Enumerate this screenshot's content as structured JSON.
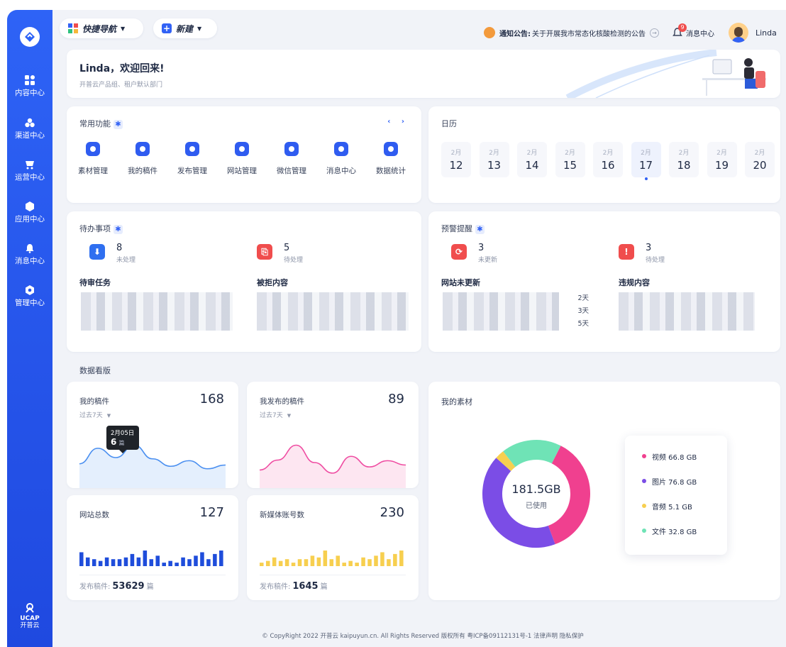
{
  "sidebar": {
    "items": [
      {
        "label": "内容中心",
        "icon": "grid-icon"
      },
      {
        "label": "渠道中心",
        "icon": "channels-icon"
      },
      {
        "label": "运营中心",
        "icon": "cart-icon"
      },
      {
        "label": "应用中心",
        "icon": "cube-icon"
      },
      {
        "label": "消息中心",
        "icon": "bell-icon"
      },
      {
        "label": "管理中心",
        "icon": "gear-icon"
      }
    ],
    "brand": "UCAP",
    "brand_sub": "开普云"
  },
  "topbar": {
    "quick_nav": "快捷导航",
    "new_label": "新建",
    "notice_label": "通知公告:",
    "notice_text": "关于开展我市常态化核酸检测的公告",
    "message_center": "消息中心",
    "message_count": "9",
    "user": "Linda"
  },
  "welcome": {
    "title": "Linda，欢迎回来!",
    "subtitle": "开普云产品组、租户默认部门"
  },
  "quick_functions": {
    "title": "常用功能",
    "items": [
      "素材管理",
      "我的稿件",
      "发布管理",
      "网站管理",
      "微信管理",
      "消息中心",
      "数据统计"
    ]
  },
  "calendar": {
    "title": "日历",
    "days": [
      {
        "month": "2月",
        "day": "12"
      },
      {
        "month": "2月",
        "day": "13"
      },
      {
        "month": "2月",
        "day": "14"
      },
      {
        "month": "2月",
        "day": "15"
      },
      {
        "month": "2月",
        "day": "16"
      },
      {
        "month": "2月",
        "day": "17"
      },
      {
        "month": "2月",
        "day": "18"
      },
      {
        "month": "2月",
        "day": "19"
      },
      {
        "month": "2月",
        "day": "20"
      }
    ],
    "selected_day": "17"
  },
  "todo": {
    "title": "待办事项",
    "groups": [
      {
        "count": "8",
        "status": "未处理",
        "label": "待审任务"
      },
      {
        "count": "5",
        "status": "待处理",
        "label": "被拒内容"
      }
    ]
  },
  "alerts": {
    "title": "预警提醒",
    "groups": [
      {
        "count": "3",
        "status": "未更新",
        "label": "网站未更新",
        "days": [
          "2天",
          "3天",
          "5天"
        ]
      },
      {
        "count": "3",
        "status": "待处理",
        "label": "违规内容"
      }
    ]
  },
  "dashboard": {
    "title": "数据看版",
    "my_drafts": {
      "title": "我的稿件",
      "value": "168",
      "period": "过去7天",
      "tooltip_date": "2月05日",
      "tooltip_value": "6",
      "tooltip_unit": "篇"
    },
    "my_published": {
      "title": "我发布的稿件",
      "value": "89",
      "period": "过去7天"
    },
    "site_total": {
      "title": "网站总数",
      "value": "127",
      "foot_label": "发布稿件:",
      "foot_value": "53629",
      "foot_unit": "篇"
    },
    "media_accounts": {
      "title": "新媒体账号数",
      "value": "230",
      "foot_label": "发布稿件:",
      "foot_value": "1645",
      "foot_unit": "篇"
    }
  },
  "materials": {
    "title": "我的素材",
    "total": "181.5GB",
    "total_label": "已使用",
    "colors": {
      "视频": "#f0408f",
      "图片": "#7b4de6",
      "音频": "#f7cf4f",
      "文件": "#6fe3b6"
    }
  },
  "chart_data": [
    {
      "type": "pie",
      "title": "我的素材",
      "categories": [
        "视频",
        "图片",
        "音频",
        "文件"
      ],
      "values": [
        66.8,
        76.8,
        5.1,
        32.8
      ],
      "units": "GB",
      "legend_labels": [
        "视频  66.8 GB",
        "图片  76.8 GB",
        "音频  5.1 GB",
        "文件  32.8 GB"
      ]
    },
    {
      "type": "area",
      "title": "我的稿件",
      "x": [
        "1",
        "2",
        "3",
        "4",
        "5",
        "6",
        "7",
        "8",
        "9"
      ],
      "values": [
        3,
        5.5,
        4,
        6,
        3.8,
        2.6,
        3.5,
        2.2,
        2.8
      ]
    },
    {
      "type": "area",
      "title": "我发布的稿件",
      "x": [
        "1",
        "2",
        "3",
        "4",
        "5",
        "6",
        "7",
        "8",
        "9"
      ],
      "values": [
        2,
        3.6,
        6,
        3.2,
        1.5,
        4.2,
        2.5,
        3.5,
        2.8
      ]
    },
    {
      "type": "bar",
      "title": "网站总数",
      "values": [
        8,
        5,
        4,
        3,
        5,
        4,
        4,
        5,
        7,
        5,
        9,
        4,
        6,
        2,
        3,
        2,
        5,
        4,
        6,
        8,
        4,
        7,
        9
      ]
    },
    {
      "type": "bar",
      "title": "新媒体账号数",
      "values": [
        2,
        3,
        5,
        3,
        4,
        2,
        4,
        4,
        6,
        5,
        9,
        4,
        6,
        2,
        3,
        2,
        5,
        4,
        6,
        8,
        4,
        7,
        9
      ]
    }
  ]
}
